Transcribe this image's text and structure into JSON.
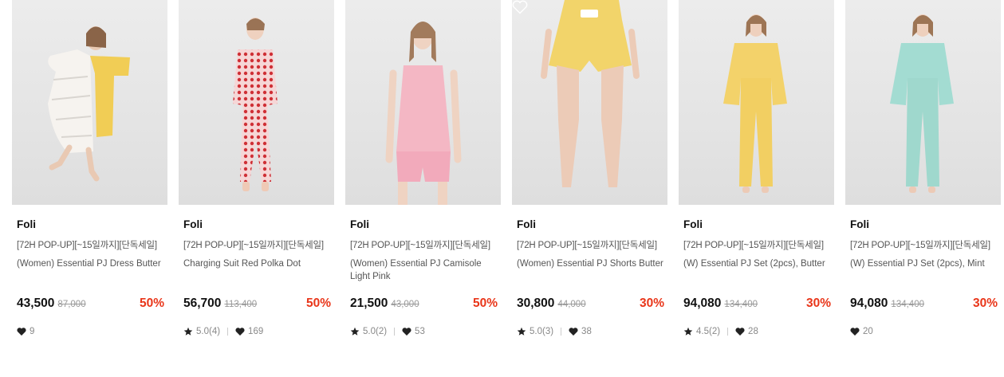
{
  "colors": {
    "discount": "#e9361a",
    "text": "#111111",
    "muted": "#888888"
  },
  "products": [
    {
      "brand": "Foli",
      "tag": "[72H POP-UP][~15일까지][단독세일]",
      "name": "(Women) Essential PJ Dress Butter",
      "price": "43,500",
      "original_price": "87,000",
      "discount": "50%",
      "rating": "",
      "likes": "9",
      "image": "model in yellow dress holding white duvet"
    },
    {
      "brand": "Foli",
      "tag": "[72H POP-UP][~15일까지][단독세일]",
      "name": "Charging Suit Red Polka Dot",
      "price": "56,700",
      "original_price": "113,400",
      "discount": "50%",
      "rating": "5.0(4)",
      "likes": "169",
      "image": "model in red polka dot pajama set"
    },
    {
      "brand": "Foli",
      "tag": "[72H POP-UP][~15일까지][단독세일]",
      "name": "(Women) Essential PJ Camisole Light Pink",
      "price": "21,500",
      "original_price": "43,000",
      "discount": "50%",
      "rating": "5.0(2)",
      "likes": "53",
      "image": "model in light pink camisole and shorts"
    },
    {
      "brand": "Foli",
      "tag": "[72H POP-UP][~15일까지][단독세일]",
      "name": "(Women) Essential PJ Shorts Butter",
      "price": "30,800",
      "original_price": "44,000",
      "discount": "30%",
      "rating": "5.0(3)",
      "likes": "38",
      "image": "legs in butter yellow shorts"
    },
    {
      "brand": "Foli",
      "tag": "[72H POP-UP][~15일까지][단독세일]",
      "name": "(W) Essential PJ Set (2pcs), Butter",
      "price": "94,080",
      "original_price": "134,400",
      "discount": "30%",
      "rating": "4.5(2)",
      "likes": "28",
      "image": "model in butter yellow pajama set"
    },
    {
      "brand": "Foli",
      "tag": "[72H POP-UP][~15일까지][단독세일]",
      "name": "(W) Essential PJ Set (2pcs), Mint",
      "price": "94,080",
      "original_price": "134,400",
      "discount": "30%",
      "rating": "",
      "likes": "20",
      "image": "model in mint pajama set"
    }
  ]
}
